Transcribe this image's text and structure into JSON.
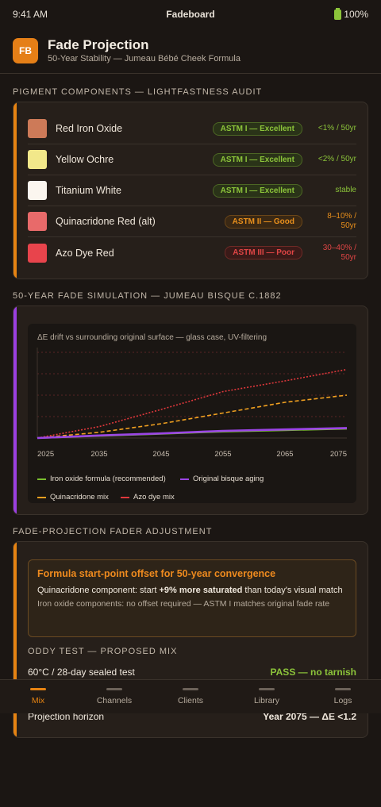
{
  "status": {
    "time": "9:41 AM",
    "title": "Fadeboard",
    "battery": "100%"
  },
  "header": {
    "logo": "FB",
    "title": "Fade Projection",
    "subtitle": "50-Year Stability — Jumeau Bébé Cheek Formula"
  },
  "pigments": {
    "heading": "PIGMENT COMPONENTS — LIGHTFASTNESS AUDIT",
    "items": [
      {
        "name": "Red Iron Oxide",
        "swatch": "#cd7a58",
        "badge": "ASTM I — Excellent",
        "level": "excellent",
        "rate": "<1% / 50yr",
        "rate_color": "green"
      },
      {
        "name": "Yellow Ochre",
        "swatch": "#f2e88a",
        "badge": "ASTM I — Excellent",
        "level": "excellent",
        "rate": "<2% / 50yr",
        "rate_color": "green"
      },
      {
        "name": "Titanium White",
        "swatch": "#fbf6ef",
        "badge": "ASTM I — Excellent",
        "level": "excellent",
        "rate": "stable",
        "rate_color": "green"
      },
      {
        "name": "Quinacridone Red (alt)",
        "swatch": "#e86a6a",
        "badge": "ASTM II — Good",
        "level": "good",
        "rate": "8–10% / 50yr",
        "rate_color": "orange"
      },
      {
        "name": "Azo Dye Red",
        "swatch": "#e8444c",
        "badge": "ASTM III — Poor",
        "level": "poor",
        "rate": "30–40% / 50yr",
        "rate_color": "red"
      }
    ]
  },
  "simulation": {
    "heading": "50-YEAR FADE SIMULATION — JUMEAU BISQUE C.1882",
    "caption": "ΔE drift vs surrounding original surface — glass case, UV-filtering"
  },
  "chart_data": {
    "type": "line",
    "title": "ΔE drift vs surrounding original surface — glass case, UV-filtering",
    "x": [
      2025,
      2035,
      2045,
      2055,
      2065,
      2075
    ],
    "xlim": [
      2025,
      2075
    ],
    "ylim": [
      0,
      12
    ],
    "grid": true,
    "legend": "bottom",
    "series": [
      {
        "name": "Iron oxide formula (recommended)",
        "color": "#7bbf2f",
        "style": "solid",
        "values": [
          0.0,
          0.3,
          0.6,
          0.9,
          1.1,
          1.3
        ]
      },
      {
        "name": "Original bisque aging",
        "color": "#9b45e6",
        "style": "solid",
        "values": [
          0.0,
          0.35,
          0.65,
          1.0,
          1.2,
          1.4
        ]
      },
      {
        "name": "Quinacridone mix",
        "color": "#f0a020",
        "style": "dashed",
        "values": [
          0.0,
          0.8,
          2.0,
          3.5,
          5.0,
          6.0
        ]
      },
      {
        "name": "Azo dye mix",
        "color": "#e0383c",
        "style": "dotted",
        "values": [
          0.0,
          1.6,
          4.0,
          6.5,
          8.0,
          9.6
        ]
      }
    ]
  },
  "fader": {
    "heading": "FADE-PROJECTION FADER ADJUSTMENT",
    "offset_title": "Formula start-point offset for 50-year convergence",
    "offset_prefix": "Quinacridone component: start ",
    "offset_bold": "+9% more saturated",
    "offset_suffix": " than today's visual match",
    "offset_note": "Iron oxide components: no offset required — ASTM I matches original fade rate",
    "oddy_heading": "ODDY TEST — PROPOSED MIX",
    "oddy_key": "60°C / 28-day sealed test",
    "oddy_value": "PASS — no tarnish",
    "horizon_key": "Projection horizon",
    "horizon_value": "Year 2075 — ΔE <1.2"
  },
  "tabs": [
    {
      "label": "Mix",
      "active": true
    },
    {
      "label": "Channels",
      "active": false
    },
    {
      "label": "Clients",
      "active": false
    },
    {
      "label": "Library",
      "active": false
    },
    {
      "label": "Logs",
      "active": false
    }
  ]
}
